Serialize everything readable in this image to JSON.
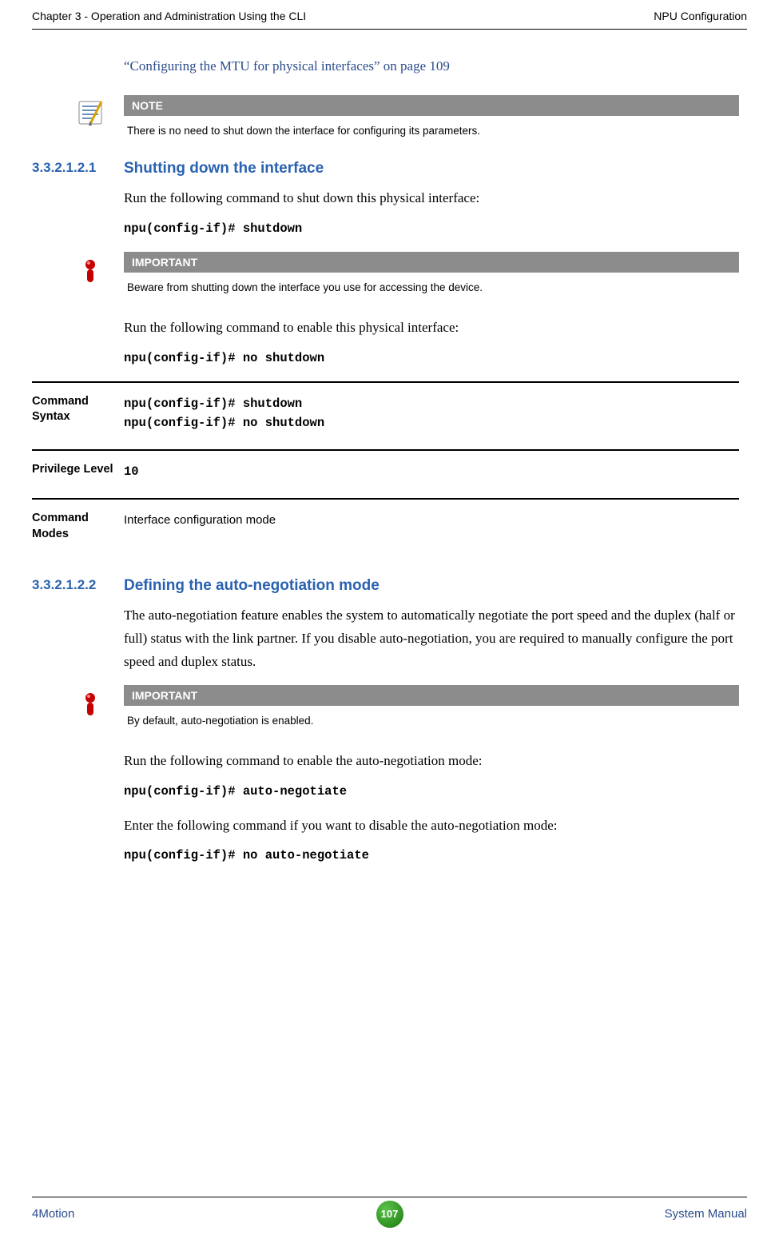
{
  "header": {
    "left": "Chapter 3 - Operation and Administration Using the CLI",
    "right": "NPU Configuration"
  },
  "top_link": "“Configuring the MTU for physical interfaces” on page 109",
  "note1": {
    "header": "NOTE",
    "text": "There is no need to shut down the interface for configuring its parameters."
  },
  "sec1": {
    "num": "3.3.2.1.2.1",
    "title": "Shutting down the interface",
    "p1": "Run the following command to shut down this physical interface:",
    "code1": "npu(config-if)# shutdown",
    "imp": {
      "header": "IMPORTANT",
      "text": "Beware from shutting down the interface you use for accessing the device."
    },
    "p2": "Run the following command to enable this physical interface:",
    "code2": "npu(config-if)# no shutdown",
    "ref": {
      "r1_label": "Command Syntax",
      "r1_v1": "npu(config-if)# shutdown",
      "r1_v2": "npu(config-if)# no shutdown",
      "r2_label": "Privilege Level",
      "r2_v": "10",
      "r3_label": "Command Modes",
      "r3_v": "Interface configuration mode"
    }
  },
  "sec2": {
    "num": "3.3.2.1.2.2",
    "title": "Defining the auto-negotiation mode",
    "p1": "The auto-negotiation feature enables the system to automatically negotiate the port speed and the duplex (half or full) status with the link partner. If you disable auto-negotiation, you are required to manually configure the port speed and duplex status.",
    "imp": {
      "header": "IMPORTANT",
      "text": "By default, auto-negotiation is enabled."
    },
    "p2": "Run the following command to enable the auto-negotiation mode:",
    "code1": "npu(config-if)# auto-negotiate",
    "p3": "Enter the following command if you want to disable the auto-negotiation mode:",
    "code2": "npu(config-if)# no auto-negotiate"
  },
  "footer": {
    "left": "4Motion",
    "page": "107",
    "right": "System Manual"
  }
}
